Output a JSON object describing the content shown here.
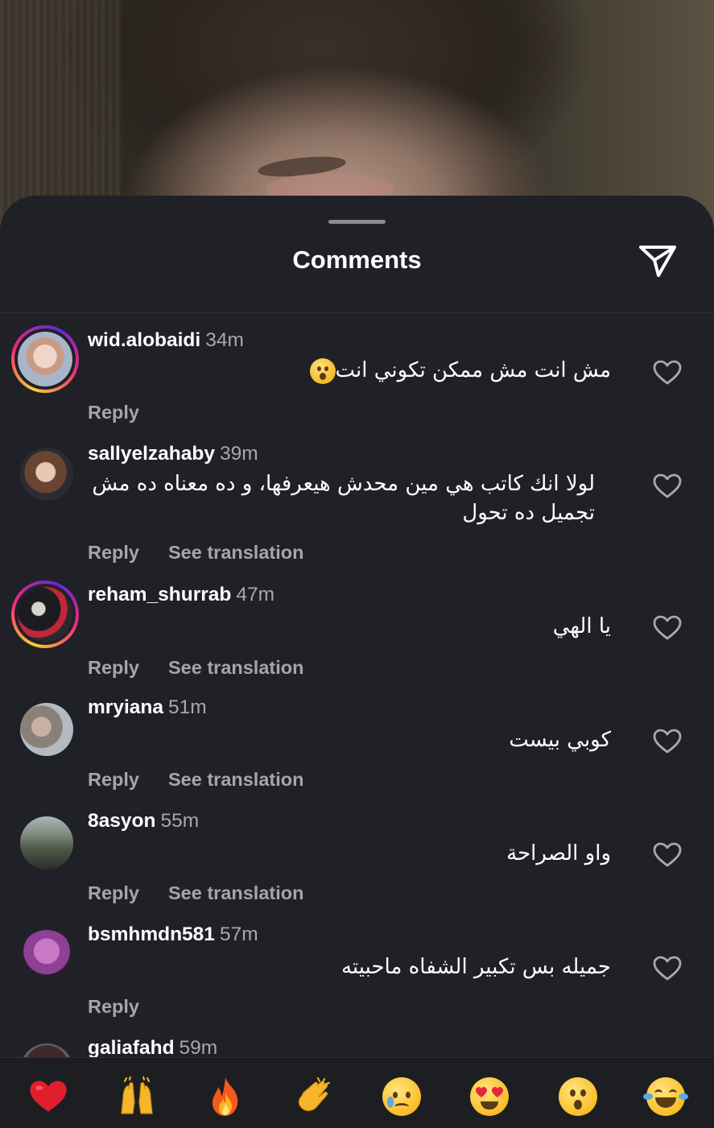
{
  "sheet": {
    "title": "Comments"
  },
  "comments": [
    {
      "username": "wid.alobaidi",
      "time": "34m",
      "text": "مش انت مش ممكن تكوني انت",
      "emoji": "hushed-face",
      "reply_label": "Reply",
      "translation_label": null,
      "avatar_ring": true
    },
    {
      "username": "sallyelzahaby",
      "time": "39m",
      "text": "لولا انك كاتب هي مين محدش هيعرفها، و ده معناه ده مش تجميل ده تحول",
      "reply_label": "Reply",
      "translation_label": "See translation",
      "avatar_ring": false
    },
    {
      "username": "reham_shurrab",
      "time": "47m",
      "text": "يا الهي",
      "reply_label": "Reply",
      "translation_label": "See translation",
      "avatar_ring": true
    },
    {
      "username": "mryiana",
      "time": "51m",
      "text": "كوبي بيست",
      "reply_label": "Reply",
      "translation_label": "See translation",
      "avatar_ring": false
    },
    {
      "username": "8asyon",
      "time": "55m",
      "text": "واو الصراحة",
      "reply_label": "Reply",
      "translation_label": "See translation",
      "avatar_ring": false
    },
    {
      "username": "bsmhmdn581",
      "time": "57m",
      "text": "جميله بس تكبير الشفاه ماحبيته",
      "reply_label": "Reply",
      "translation_label": null,
      "avatar_ring": false
    },
    {
      "username": "galiafahd",
      "time": "59m",
      "avatar_ring": false
    }
  ],
  "reactions": [
    {
      "name": "red-heart",
      "glyph": "❤️"
    },
    {
      "name": "raising-hands",
      "glyph": "🙌"
    },
    {
      "name": "fire",
      "glyph": "🔥"
    },
    {
      "name": "clapping-hands",
      "glyph": "👏"
    },
    {
      "name": "crying-face",
      "glyph": "😢"
    },
    {
      "name": "heart-eyes",
      "glyph": "😍"
    },
    {
      "name": "hushed-face",
      "glyph": "😮"
    },
    {
      "name": "tears-of-joy",
      "glyph": "😂"
    }
  ],
  "colors": {
    "sheet_background": "#202126",
    "username": "#ffffff",
    "secondary_text": "#a8a8ad",
    "story_ring": [
      "#f9ce34",
      "#ee2a7b",
      "#6228d7"
    ]
  },
  "icons": {
    "share": "paper-plane-icon",
    "like": "heart-outline-icon"
  }
}
